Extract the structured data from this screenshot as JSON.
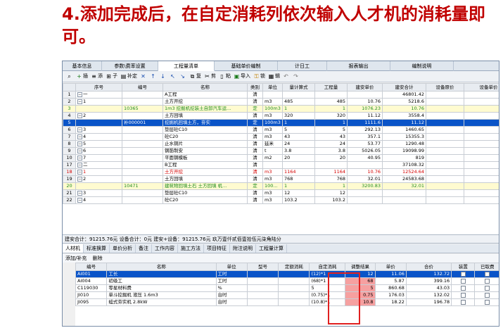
{
  "heading": "4.添加完成后，在自定消耗列依次输入人才机的消耗量即可。",
  "tabs": [
    "基本信息",
    "参数\\费率设置",
    "工程量清单",
    "基础单价编制",
    "计日工",
    "报表输出",
    "编制说明"
  ],
  "toolbar": {
    "insert": "插",
    "add": "添",
    "child": "子",
    "supplement": "补定",
    "cut": "剪",
    "copy": "复",
    "paste": "粘",
    "import": "导入",
    "lock": "锁",
    "edit": "辑"
  },
  "grid": {
    "headers": [
      "序号",
      "编号",
      "名称",
      "类别",
      "单位",
      "量计算式",
      "工程量",
      "建安单价",
      "建安合计",
      "设备原价",
      "设备单价"
    ],
    "rows": [
      {
        "n": "1",
        "seq": "一",
        "code": "",
        "name": "A工程",
        "cat": "清",
        "unit": "",
        "formula": "",
        "qty": "",
        "price": "",
        "total": "46801.42",
        "style": ""
      },
      {
        "n": "2",
        "seq": "1",
        "code": "",
        "name": "土方开挖",
        "cat": "清",
        "unit": "m3",
        "formula": "485",
        "qty": "485",
        "price": "10.76",
        "total": "5218.6",
        "style": ""
      },
      {
        "n": "3",
        "seq": "",
        "code": "10365",
        "name": "1m3 挖掘机挖装土自卸汽车运...",
        "cat": "定",
        "unit": "100m3",
        "formula": "1",
        "qty": "1",
        "price": "1076.23",
        "total": "10.76",
        "style": "yellow green"
      },
      {
        "n": "4",
        "seq": "2",
        "code": "",
        "name": "土方回填",
        "cat": "清",
        "unit": "m3",
        "formula": "320",
        "qty": "320",
        "price": "11.12",
        "total": "3558.4",
        "style": ""
      },
      {
        "n": "5",
        "seq": "",
        "code": "补000001",
        "name": "挖掘机回填土方，夯实",
        "cat": "定",
        "unit": "100m3",
        "formula": "1",
        "qty": "1",
        "price": "1111.6",
        "total": "11.12",
        "style": "sel"
      },
      {
        "n": "6",
        "seq": "3",
        "code": "",
        "name": "垫层砼C10",
        "cat": "清",
        "unit": "m3",
        "formula": "5",
        "qty": "5",
        "price": "292.13",
        "total": "1460.65",
        "style": ""
      },
      {
        "n": "7",
        "seq": "4",
        "code": "",
        "name": "砼C20",
        "cat": "清",
        "unit": "m3",
        "formula": "43",
        "qty": "43",
        "price": "357.1",
        "total": "15355.3",
        "style": ""
      },
      {
        "n": "8",
        "seq": "5",
        "code": "",
        "name": "止水铜片",
        "cat": "清",
        "unit": "延米",
        "formula": "24",
        "qty": "24",
        "price": "53.77",
        "total": "1290.48",
        "style": ""
      },
      {
        "n": "9",
        "seq": "6",
        "code": "",
        "name": "钢筋制安",
        "cat": "清",
        "unit": "t",
        "formula": "3.8",
        "qty": "3.8",
        "price": "5026.05",
        "total": "19098.99",
        "style": ""
      },
      {
        "n": "10",
        "seq": "7",
        "code": "",
        "name": "平面钢模板",
        "cat": "清",
        "unit": "m2",
        "formula": "20",
        "qty": "20",
        "price": "40.95",
        "total": "819",
        "style": ""
      },
      {
        "n": "17",
        "seq": "二",
        "code": "",
        "name": "B工程",
        "cat": "清",
        "unit": "",
        "formula": "",
        "qty": "",
        "price": "",
        "total": "37108.32",
        "style": ""
      },
      {
        "n": "18",
        "seq": "1",
        "code": "",
        "name": "土方开挖",
        "cat": "清",
        "unit": "m3",
        "formula": "1164",
        "qty": "1164",
        "price": "10.76",
        "total": "12524.64",
        "style": "red"
      },
      {
        "n": "19",
        "seq": "2",
        "code": "",
        "name": "土方回填",
        "cat": "清",
        "unit": "m3",
        "formula": "768",
        "qty": "768",
        "price": "32.01",
        "total": "24583.68",
        "style": ""
      },
      {
        "n": "20",
        "seq": "",
        "code": "10471",
        "name": "建筑物回填土石 土方回填 机...",
        "cat": "定",
        "unit": "100...",
        "formula": "1",
        "qty": "1",
        "price": "3200.83",
        "total": "32.01",
        "style": "yellow green"
      },
      {
        "n": "21",
        "seq": "3",
        "code": "",
        "name": "垫层砼C10",
        "cat": "清",
        "unit": "m3",
        "formula": "12",
        "qty": "12",
        "price": "",
        "total": "",
        "style": ""
      },
      {
        "n": "22",
        "seq": "4",
        "code": "",
        "name": "砼C20",
        "cat": "清",
        "unit": "m3",
        "formula": "103.2",
        "qty": "103.2",
        "price": "",
        "total": "",
        "style": ""
      }
    ]
  },
  "status": "建安合计：91215.76元  设备合计：0元  建安+设备：91215.76元  玖万壹仟贰佰壹拾伍元柒角陆分",
  "bottom_tabs": [
    "人材机",
    "标准换算",
    "单价分析",
    "备注",
    "工作内容",
    "施工方法",
    "项目特征",
    "附注说明",
    "工程量计算"
  ],
  "bottom_toolbar": [
    "添加/补充",
    "删除"
  ],
  "bgrid": {
    "headers": [
      "编号",
      "名称",
      "单位",
      "型号",
      "定额消耗",
      "自定消耗",
      "调整结果",
      "单价",
      "合价",
      "装置",
      "已取费"
    ],
    "rows": [
      {
        "code": "AI001",
        "name": "工长",
        "unit": "工时",
        "model": "",
        "quota": "",
        "custom": "(12)*1",
        "adj": "12",
        "price": "11.06",
        "total": "132.72",
        "sel": true
      },
      {
        "code": "AI004",
        "name": "初级工",
        "unit": "工时",
        "model": "",
        "quota": "",
        "custom": "(68)*1",
        "adj": "68",
        "price": "5.87",
        "total": "399.16",
        "sel": false
      },
      {
        "code": "C119030",
        "name": "零星材料费",
        "unit": "%",
        "model": "",
        "quota": "",
        "custom": "5",
        "adj": "5",
        "price": "860.68",
        "total": "43.03",
        "sel": false
      },
      {
        "code": "JI010",
        "name": "单斗挖掘机 液压 1.6m3",
        "unit": "台时",
        "model": "",
        "quota": "",
        "custom": "(0.75)*1",
        "adj": "0.75",
        "price": "176.03",
        "total": "132.02",
        "sel": false
      },
      {
        "code": "JI095",
        "name": "蛙式夯实机 2.8kW",
        "unit": "台时",
        "model": "",
        "quota": "",
        "custom": "(10.8)*1",
        "adj": "10.8",
        "price": "18.22",
        "total": "196.78",
        "sel": false
      }
    ]
  },
  "colors": {
    "heading": "#c00000",
    "selection": "#0a54c8",
    "highlight": "#e02020",
    "adjust_bg": "#f6a0a0"
  }
}
